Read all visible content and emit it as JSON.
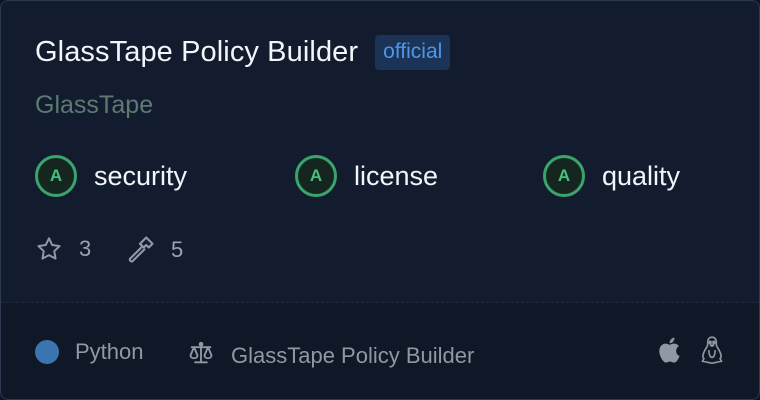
{
  "card": {
    "title": "GlassTape Policy Builder",
    "badge": "official",
    "author": "GlassTape"
  },
  "scores": [
    {
      "grade": "A",
      "label": "security"
    },
    {
      "grade": "A",
      "label": "license"
    },
    {
      "grade": "A",
      "label": "quality"
    }
  ],
  "stats": {
    "stars": "3",
    "tools": "5",
    "star_icon": "star-icon",
    "tool_icon": "hammer-icon"
  },
  "footer": {
    "language": "Python",
    "language_color": "#3a75b0",
    "license": "GlassTape Policy Builder",
    "license_icon": "scale-icon",
    "platforms": [
      "apple-icon",
      "linux-icon"
    ]
  },
  "colors": {
    "accent_green": "#3aa46c",
    "badge_blue": "#4f95e8"
  }
}
